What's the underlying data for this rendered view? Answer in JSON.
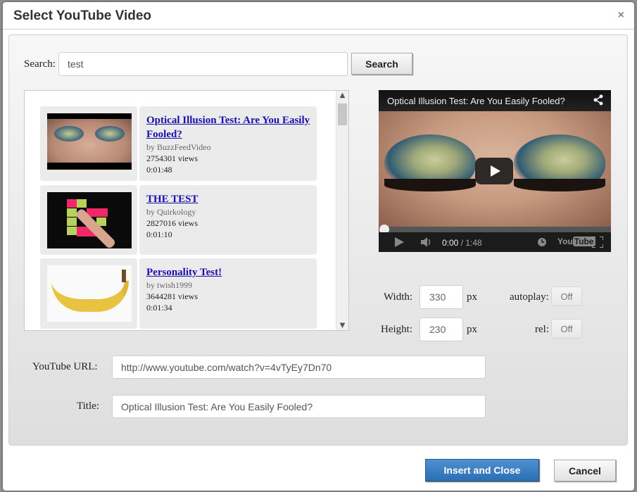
{
  "dialog": {
    "title": "Select YouTube Video",
    "close_icon": "×"
  },
  "search": {
    "label": "Search:",
    "value": "test",
    "button_label": "Search"
  },
  "results": [
    {
      "title": "Optical Illusion Test: Are You Easily Fooled?",
      "by": "by BuzzFeedVideo",
      "views": "2754301 views",
      "duration": "0:01:48",
      "thumbnail": "eyeshadow-closeup"
    },
    {
      "title": "THE TEST",
      "by": "by Quirkology",
      "views": "2827016 views",
      "duration": "0:01:10",
      "thumbnail": "sticky-notes-hand"
    },
    {
      "title": "Personality Test!",
      "by": "by twish1999",
      "views": "3644281 views",
      "duration": "0:01:34",
      "thumbnail": "banana"
    }
  ],
  "player": {
    "title": "Optical Illusion Test: Are You Easily Fooled?",
    "current_time": "0:00",
    "total_time": "/ 1:48",
    "logo_you": "You",
    "logo_tube": "Tube",
    "progress": 0
  },
  "options": {
    "width_label": "Width:",
    "width_value": "330",
    "width_unit": "px",
    "height_label": "Height:",
    "height_value": "230",
    "height_unit": "px",
    "autoplay_label": "autoplay:",
    "autoplay_value": "Off",
    "rel_label": "rel:",
    "rel_value": "Off"
  },
  "fields": {
    "url_label": "YouTube URL:",
    "url_value": "http://www.youtube.com/watch?v=4vTyEy7Dn70",
    "title_label": "Title:",
    "title_value": "Optical Illusion Test: Are You Easily Fooled?"
  },
  "footer": {
    "insert_label": "Insert and Close",
    "cancel_label": "Cancel"
  },
  "colors": {
    "primary": "#2f77bd",
    "link": "#1a0dab"
  }
}
